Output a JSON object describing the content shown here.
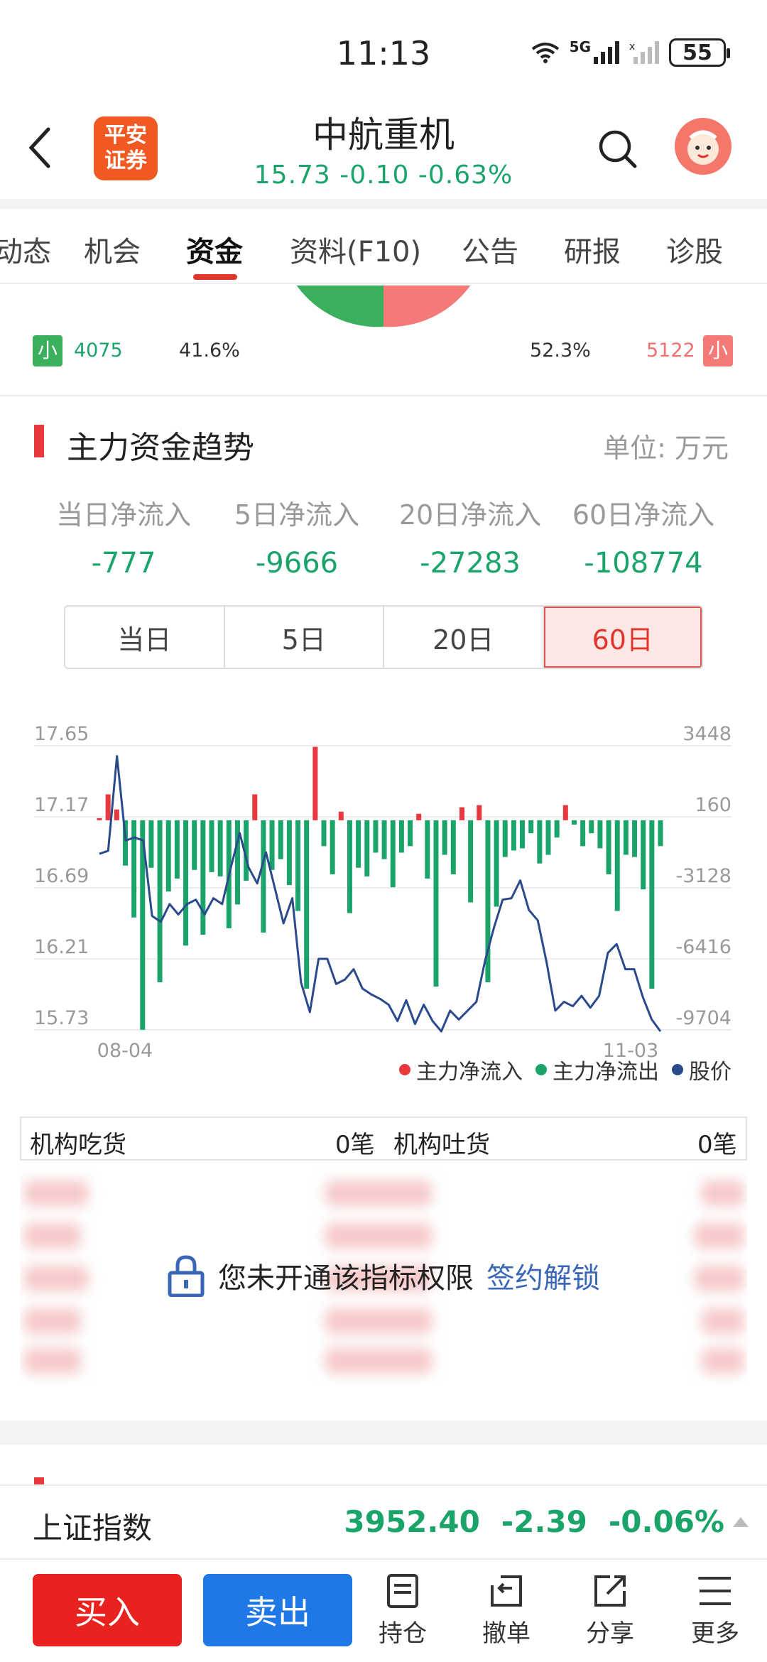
{
  "status_bar": {
    "time": "11:13",
    "network": "5G",
    "battery": "55"
  },
  "header": {
    "logo_text_line1": "平安",
    "logo_text_line2": "证券",
    "stock_name": "中航重机",
    "quote": "15.73  -0.10  -0.63%"
  },
  "tabs": [
    {
      "label": "动态"
    },
    {
      "label": "机会"
    },
    {
      "label": "资金",
      "active": true
    },
    {
      "label": "资料(F10)"
    },
    {
      "label": "公告"
    },
    {
      "label": "研报"
    },
    {
      "label": "诊股"
    }
  ],
  "pie_row": {
    "left_badge": "小",
    "left_value": "4075",
    "left_pct": "41.6%",
    "right_pct": "52.3%",
    "right_value": "5122",
    "right_badge": "小"
  },
  "trend": {
    "title": "主力资金趋势",
    "unit": "单位:  万元",
    "flows": [
      {
        "label": "当日净流入",
        "value": "-777"
      },
      {
        "label": "5日净流入",
        "value": "-9666"
      },
      {
        "label": "20日净流入",
        "value": "-27283"
      },
      {
        "label": "60日净流入",
        "value": "-108774"
      }
    ],
    "ranges": [
      {
        "label": "当日"
      },
      {
        "label": "5日"
      },
      {
        "label": "20日"
      },
      {
        "label": "60日",
        "active": true
      }
    ]
  },
  "chart_data": {
    "type": "bar",
    "left_axis_ticks": [
      "17.65",
      "17.17",
      "16.69",
      "16.21",
      "15.73"
    ],
    "right_axis_ticks": [
      "3448",
      "160",
      "-3128",
      "-6416",
      "-9704"
    ],
    "x_labels": [
      "08-04",
      "11-03"
    ],
    "y_left_range": [
      15.73,
      17.65
    ],
    "y_right_range": [
      -9704,
      3448
    ],
    "legend": [
      {
        "name": "主力净流入",
        "color": "#e8383d"
      },
      {
        "name": "主力净流出",
        "color": "#1aa469"
      },
      {
        "name": "股价",
        "color": "#2b4a8c"
      }
    ],
    "flows": [
      100,
      1200,
      500,
      -2100,
      -4500,
      -9700,
      -2200,
      -7500,
      -3300,
      -2700,
      -5800,
      -2300,
      -5300,
      -2400,
      -2600,
      -5000,
      -3900,
      -2800,
      1200,
      -5200,
      -2300,
      -1800,
      -3000,
      -4200,
      -7800,
      3400,
      -1200,
      -2500,
      400,
      -4300,
      -2200,
      -2600,
      -1500,
      -1800,
      -3100,
      -1500,
      -1200,
      300,
      -2700,
      -7700,
      -1600,
      -2500,
      600,
      -3800,
      700,
      -7500,
      -4000,
      -1700,
      -1400,
      -1300,
      -600,
      -2000,
      -1600,
      -800,
      700,
      -200,
      -1200,
      -600,
      -1300,
      -2500,
      -4200,
      -1600,
      -1700,
      -3200,
      -7800,
      -1200
    ],
    "price": [
      16.92,
      16.94,
      17.58,
      17.01,
      17.03,
      17.01,
      16.5,
      16.46,
      16.58,
      16.51,
      16.58,
      16.61,
      16.51,
      16.62,
      16.58,
      16.83,
      17.06,
      16.83,
      16.72,
      16.93,
      16.69,
      16.45,
      16.62,
      16.05,
      15.85,
      16.21,
      16.21,
      16.04,
      16.07,
      16.14,
      16.01,
      15.97,
      15.94,
      15.9,
      15.79,
      15.93,
      15.77,
      15.9,
      15.79,
      15.72,
      15.86,
      15.8,
      15.86,
      15.92,
      16.2,
      16.42,
      16.61,
      16.62,
      16.74,
      16.54,
      16.47,
      16.19,
      15.86,
      15.92,
      15.89,
      15.96,
      15.88,
      15.96,
      16.25,
      16.31,
      16.14,
      16.14,
      15.95,
      15.8,
      15.72
    ]
  },
  "institutions": {
    "buy_label": "机构吃货",
    "buy_count": "0笔",
    "sell_label": "机构吐货",
    "sell_count": "0笔"
  },
  "lock": {
    "message": "您未开通该指标权限",
    "link": "签约解锁"
  },
  "index_bar": {
    "name": "上证指数",
    "value": "3952.40",
    "change": "-2.39",
    "pct": "-0.06%"
  },
  "bottom_bar": {
    "buy": "买入",
    "sell": "卖出",
    "tools": [
      {
        "label": "持仓"
      },
      {
        "label": "撤单"
      },
      {
        "label": "分享"
      },
      {
        "label": "更多"
      }
    ]
  }
}
